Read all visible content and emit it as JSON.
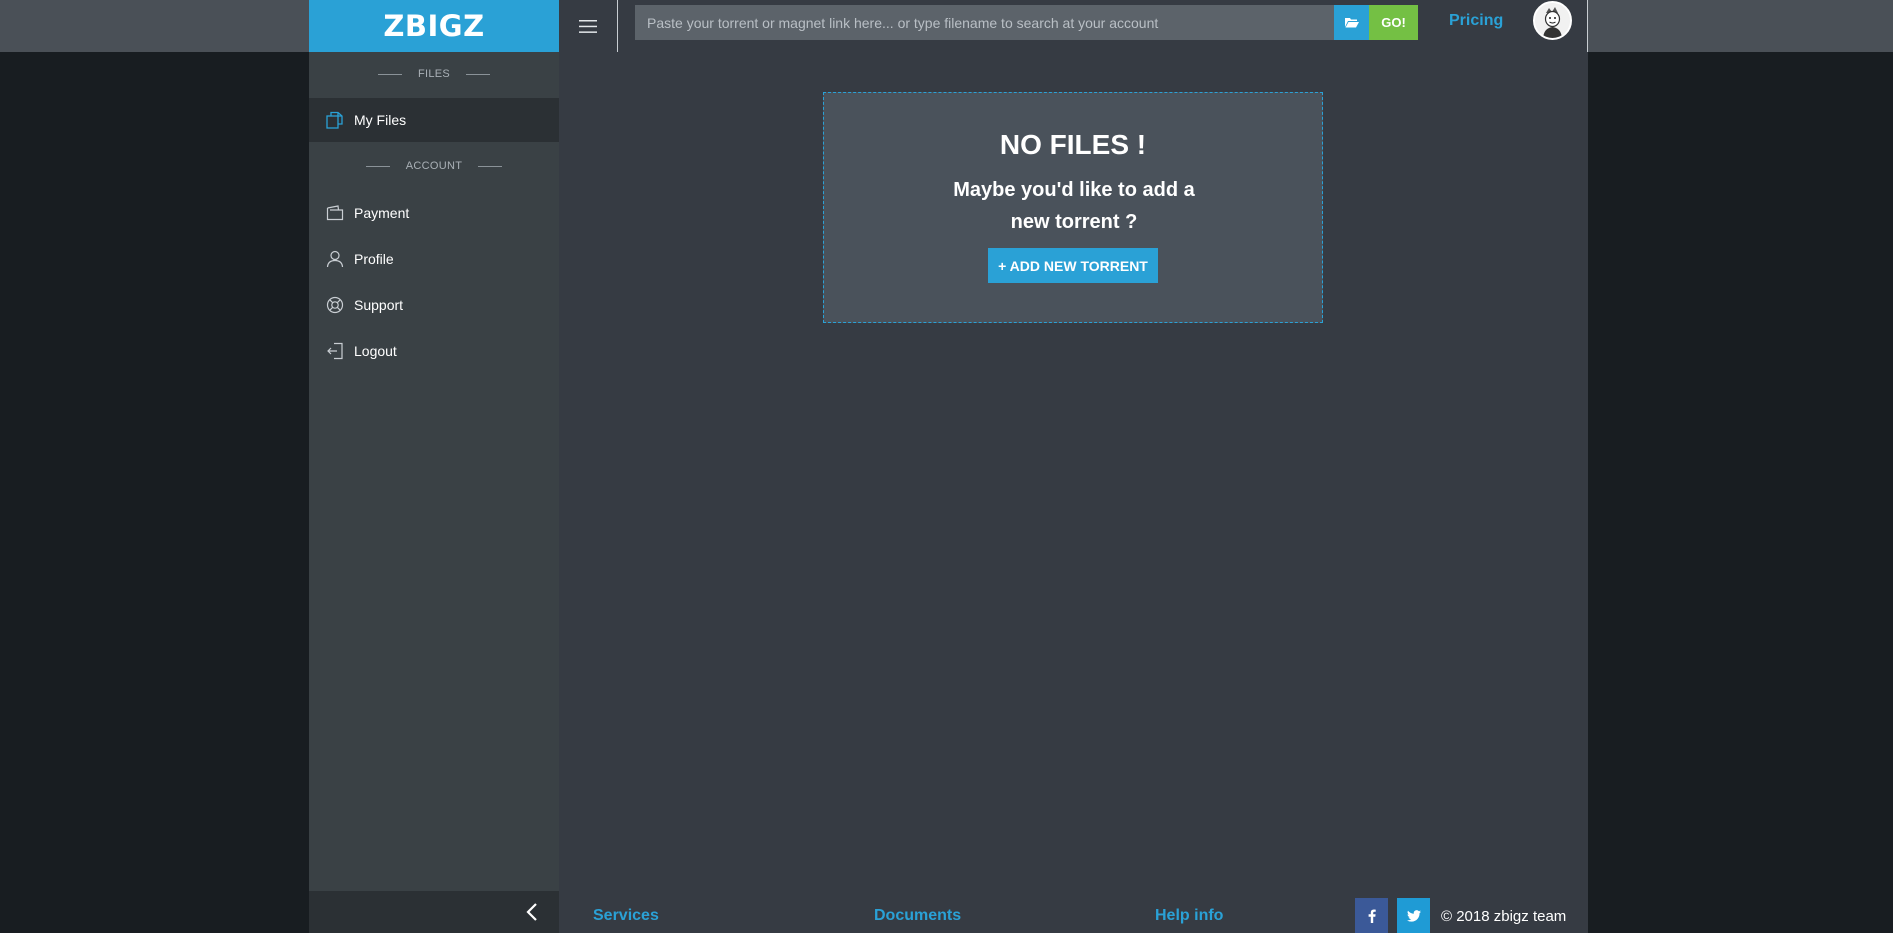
{
  "header": {
    "logo": "ZBIGZ",
    "search_placeholder": "Paste your torrent or magnet link here... or type filename to search at your account",
    "go_label": "GO!",
    "pricing_label": "Pricing"
  },
  "sidebar": {
    "files_section": "FILES",
    "account_section": "ACCOUNT",
    "items": [
      {
        "label": "My Files",
        "icon": "files-icon"
      },
      {
        "label": "Payment",
        "icon": "wallet-icon"
      },
      {
        "label": "Profile",
        "icon": "user-icon"
      },
      {
        "label": "Support",
        "icon": "lifebuoy-icon"
      },
      {
        "label": "Logout",
        "icon": "logout-icon"
      }
    ]
  },
  "main": {
    "empty_title": "NO FILES !",
    "empty_subtitle": "Maybe you'd like to add a new torrent ?",
    "add_button": "+ ADD NEW TORRENT"
  },
  "footer": {
    "links": [
      "Services",
      "Documents",
      "Help info"
    ],
    "copyright": "© 2018 zbigz team"
  },
  "colors": {
    "accent": "#2aa1d6",
    "go": "#74c044",
    "facebook": "#3b5998",
    "twitter": "#1da1f2"
  }
}
